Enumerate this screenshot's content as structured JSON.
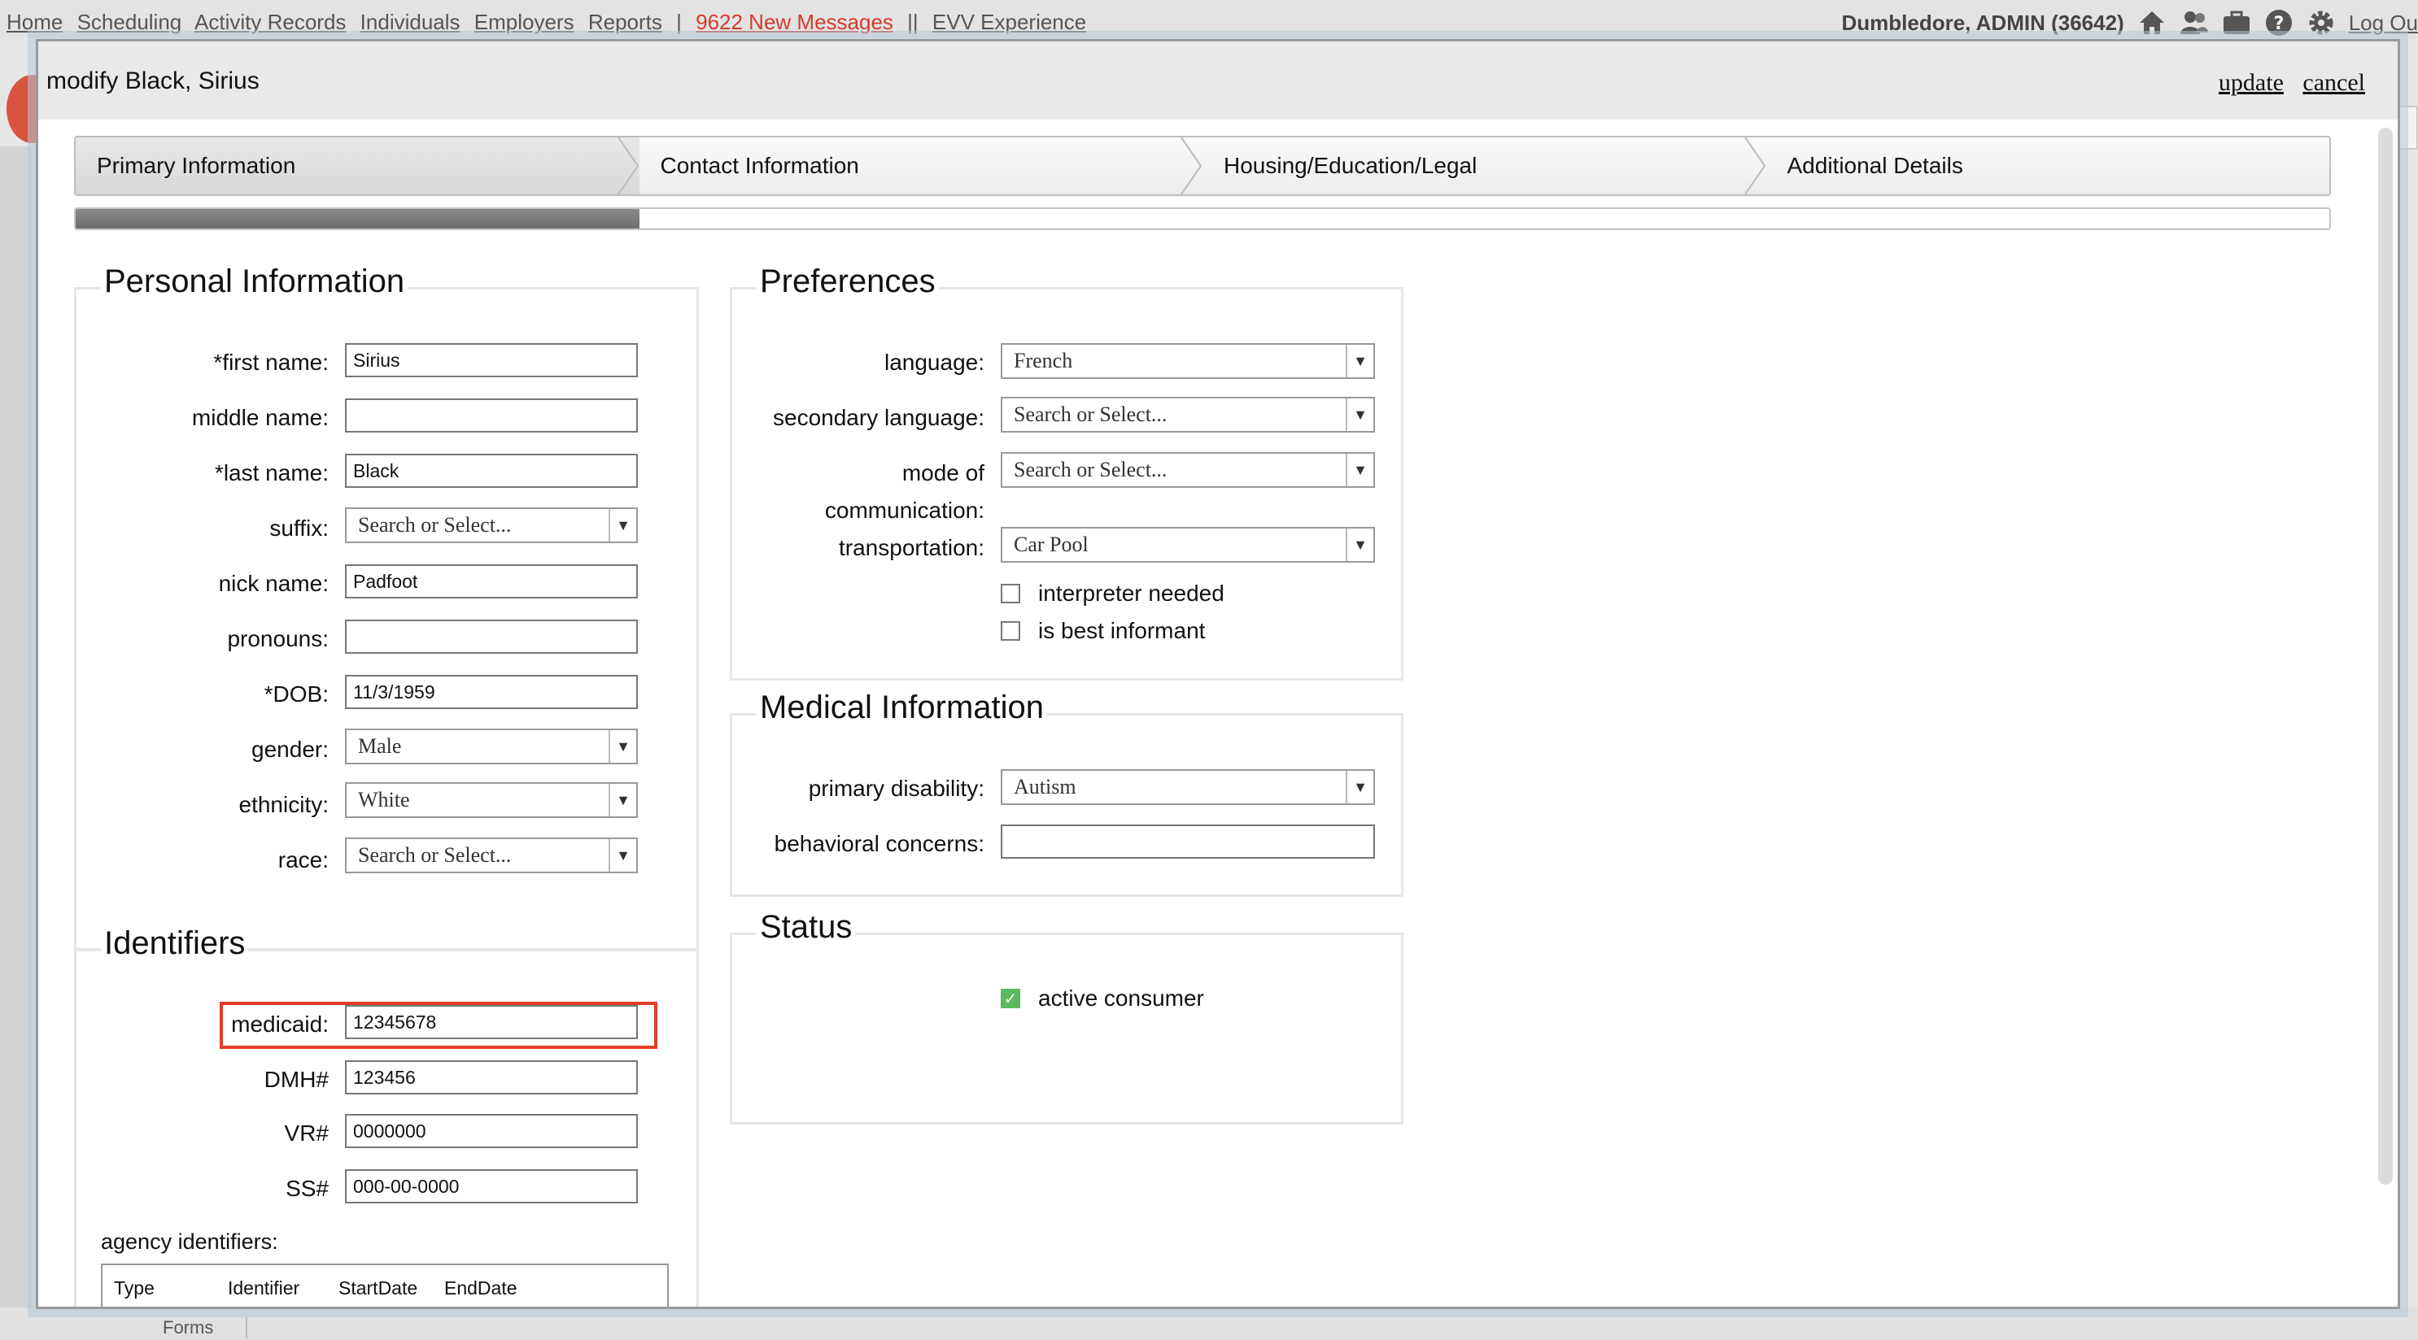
{
  "topnav": {
    "links": [
      "Home",
      "Scheduling",
      "Activity Records",
      "Individuals",
      "Employers",
      "Reports"
    ],
    "messages": "9622 New Messages",
    "evv": "EVV Experience",
    "user": "Dumbledore, ADMIN (36642)",
    "logout": "Log Ou"
  },
  "bottom": {
    "tab": "Forms"
  },
  "modal": {
    "title": "modify Black, Sirius",
    "update": "update",
    "cancel": "cancel",
    "steps": [
      "Primary Information",
      "Contact Information",
      "Housing/Education/Legal",
      "Additional Details"
    ],
    "progress_fraction": 0.25
  },
  "personal": {
    "title": "Personal Information",
    "first_name_label": "*first name:",
    "first_name": "Sirius",
    "middle_name_label": "middle name:",
    "middle_name": "",
    "last_name_label": "*last name:",
    "last_name": "Black",
    "suffix_label": "suffix:",
    "suffix": "Search or Select...",
    "nick_label": "nick name:",
    "nick": "Padfoot",
    "pronouns_label": "pronouns:",
    "pronouns": "",
    "dob_label": "*DOB:",
    "dob": "11/3/1959",
    "gender_label": "gender:",
    "gender": "Male",
    "ethnicity_label": "ethnicity:",
    "ethnicity": "White",
    "race_label": "race:",
    "race": "Search or Select..."
  },
  "identifiers": {
    "title": "Identifiers",
    "medicaid_label": "medicaid:",
    "medicaid": "12345678",
    "dmh_label": "DMH#",
    "dmh": "123456",
    "vr_label": "VR#",
    "vr": "0000000",
    "ss_label": "SS#",
    "ss": "000-00-0000",
    "agency_label": "agency identifiers:",
    "columns": [
      "Type",
      "Identifier",
      "StartDate",
      "EndDate"
    ]
  },
  "preferences": {
    "title": "Preferences",
    "language_label": "language:",
    "language": "French",
    "secondary_label": "secondary language:",
    "secondary": "Search or Select...",
    "mode_label_1": "mode of",
    "mode_label_2": "communication:",
    "mode": "Search or Select...",
    "transport_label": "transportation:",
    "transport": "Car Pool",
    "interpreter": "interpreter needed",
    "informant": "is best informant"
  },
  "medical": {
    "title": "Medical Information",
    "disability_label": "primary disability:",
    "disability": "Autism",
    "behavioral_label": "behavioral concerns:",
    "behavioral": ""
  },
  "status": {
    "title": "Status",
    "active": "active consumer"
  }
}
